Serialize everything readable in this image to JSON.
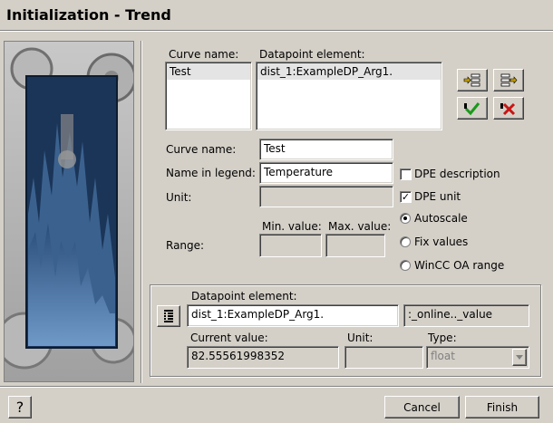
{
  "window": {
    "title": "Initialization - Trend"
  },
  "curves": {
    "curve_name_header": "Curve name:",
    "dpe_header": "Datapoint element:",
    "curve_names": [
      "Test"
    ],
    "dpe_items": [
      "dist_1:ExampleDP_Arg1."
    ]
  },
  "toolbar": {
    "add_icon": "add-curve-icon",
    "remove_icon": "remove-curve-icon",
    "apply_icon": "green-check-icon",
    "delete_icon": "red-x-icon"
  },
  "form": {
    "curve_name_label": "Curve name:",
    "curve_name_value": "Test",
    "legend_label": "Name in legend:",
    "legend_value": "Temperature",
    "unit_label": "Unit:",
    "unit_value": "",
    "range_label": "Range:",
    "min_label": "Min. value:",
    "max_label": "Max. value:",
    "min_value": "",
    "max_value": ""
  },
  "options": {
    "dpe_description_label": "DPE description",
    "dpe_description_checked": false,
    "dpe_unit_label": "DPE unit",
    "dpe_unit_checked": true,
    "autoscale_label": "Autoscale",
    "fix_values_label": "Fix values",
    "wincc_range_label": "WinCC OA range",
    "selected_range_mode": "Autoscale"
  },
  "dp_group": {
    "dpe_label": "Datapoint element:",
    "dpe_value": "dist_1:ExampleDP_Arg1.",
    "config_value": ":_online.._value",
    "current_value_label": "Current value:",
    "current_value": "82.55561998352",
    "unit_label": "Unit:",
    "unit_value": "",
    "type_label": "Type:",
    "type_value": "float",
    "selector_icon": "dp-selector-icon"
  },
  "footer": {
    "help_label": "?",
    "cancel_label": "Cancel",
    "finish_label": "Finish"
  }
}
